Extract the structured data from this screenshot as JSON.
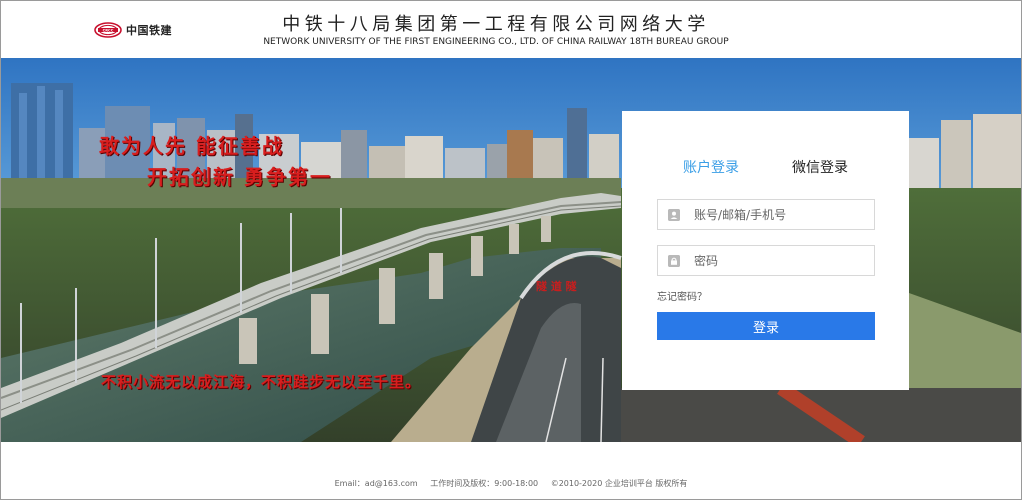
{
  "header": {
    "logo_text": "中国铁建",
    "logo_mark_text": "CRCC",
    "title_cn": "中铁十八局集团第一工程有限公司网络大学",
    "title_en": "NETWORK UNIVERSITY OF THE FIRST ENGINEERING CO., LTD. OF CHINA RAILWAY 18TH BUREAU GROUP"
  },
  "banner": {
    "slogan_line1": "敢为人先  能征善战",
    "slogan_line2": "开拓创新  勇争第一",
    "slogan_line3": "不积小流无以成江海，不积跬步无以至千里。",
    "tunnel_sign": "隧 道 隧"
  },
  "login": {
    "tab_account": "账户登录",
    "tab_wechat": "微信登录",
    "active_tab": "tab_account",
    "username_placeholder": "账号/邮箱/手机号",
    "username_value": "",
    "password_placeholder": "密码",
    "password_value": "",
    "forgot_label": "忘记密码？",
    "submit_label": "登录",
    "user_icon": "user-icon",
    "lock_icon": "lock-icon"
  },
  "footer": {
    "email": "Email：ad@163.com",
    "hours": "工作时间及版权：9:00-18:00",
    "copyright": "©2010-2020 企业培训平台 版权所有"
  },
  "colors": {
    "accent_tab": "#3a9ee6",
    "button": "#2979e8",
    "slogan": "#d81e1e",
    "sky": "#3b80c6"
  }
}
